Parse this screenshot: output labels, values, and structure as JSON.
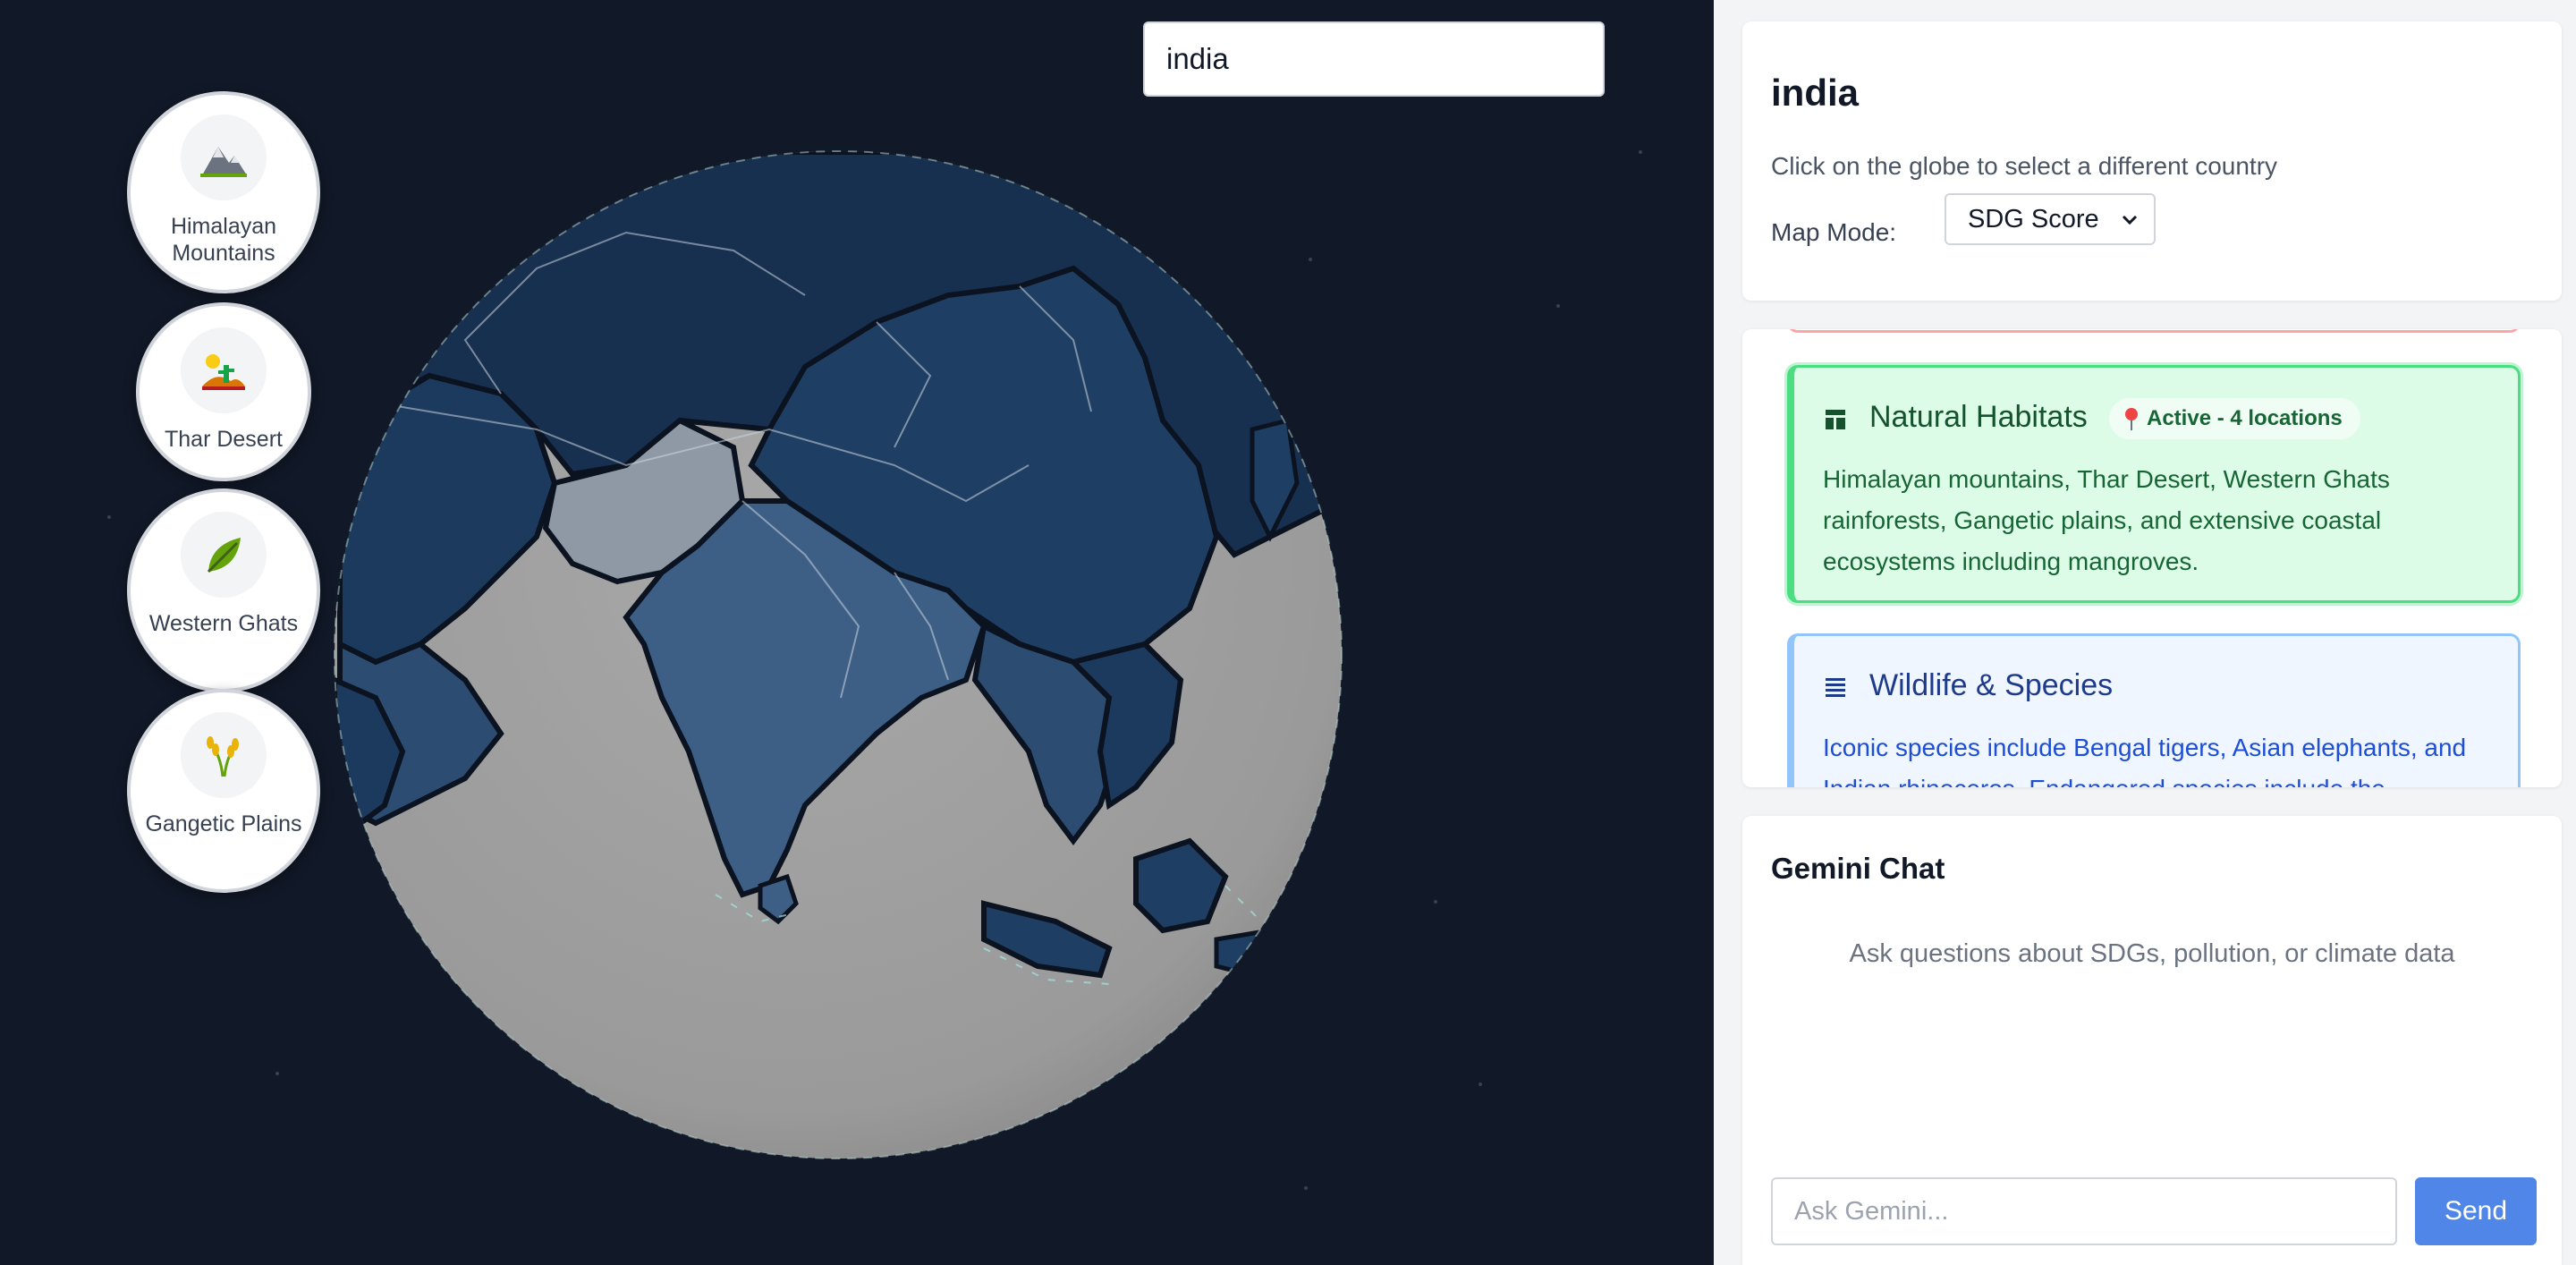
{
  "colors": {
    "page_bg": "#111827",
    "ocean": "#9b9b9b",
    "land_dark": "#1c3a5e",
    "land_mid": "#3a5a80",
    "land_light": "#9ba3ad",
    "accent_green": "#4ade80",
    "accent_blue": "#93c5fd",
    "send_button": "#4f86e8"
  },
  "habitats": [
    {
      "label": "Himalayan Mountains",
      "icon": "mountain-icon"
    },
    {
      "label": "Thar Desert",
      "icon": "desert-icon"
    },
    {
      "label": "Western Ghats",
      "icon": "leaf-icon"
    },
    {
      "label": "Gangetic Plains",
      "icon": "rice-icon"
    }
  ],
  "country": {
    "title": "india",
    "search_value": "india",
    "hint": "Click on the globe to select a different country",
    "map_mode_label": "Map Mode:",
    "map_mode_value": "SDG Score"
  },
  "info_cards": {
    "habitats": {
      "icon": "layout-icon",
      "title": "Natural Habitats",
      "badge": "Active - 4 locations",
      "body": "Himalayan mountains, Thar Desert, Western Ghats rainforests, Gangetic plains, and extensive coastal ecosystems including mangroves."
    },
    "wildlife": {
      "icon": "list-icon",
      "title": "Wildlife & Species",
      "body": "Iconic species include Bengal tigers, Asian elephants, and Indian rhinoceros. Endangered species include the"
    }
  },
  "chat": {
    "title": "Gemini Chat",
    "empty_state": "Ask questions about SDGs, pollution, or climate data",
    "input_placeholder": "Ask Gemini...",
    "send_label": "Send"
  }
}
